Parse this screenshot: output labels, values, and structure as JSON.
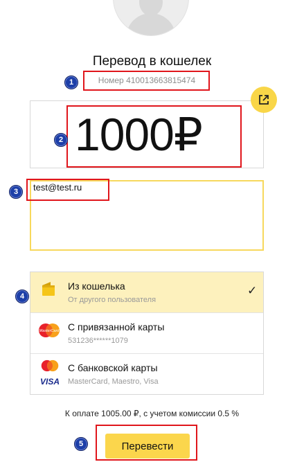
{
  "header": {
    "title": "Перевод в кошелек",
    "number_label": "Номер 410013663815474"
  },
  "amount": {
    "value": "1000",
    "currency": "₽"
  },
  "comment": {
    "value": "test@test.ru"
  },
  "payment_options": [
    {
      "label": "Из кошелька",
      "sub": "От другого пользователя",
      "selected": true,
      "icon": "wallet-icon"
    },
    {
      "label": "С привязанной карты",
      "sub": "531236******1079",
      "selected": false,
      "icon": "mastercard-icon"
    },
    {
      "label": "С банковской карты",
      "sub": "MasterCard, Maestro, Visa",
      "selected": false,
      "icon": "mastercard-visa-icon"
    }
  ],
  "card_icons": {
    "mastercard": "MasterCard",
    "visa": "VISA"
  },
  "selected_mark": "✓",
  "total": "К оплате 1005.00 ₽, с учетом комиссии 0.5 %",
  "pay_button": "Перевести",
  "annotations": [
    "1",
    "2",
    "3",
    "4",
    "5"
  ],
  "colors": {
    "accent": "#fbd64c",
    "selected_bg": "#fdf1bd",
    "highlight_border": "#e0151b",
    "badge": "#1d3fa8"
  }
}
